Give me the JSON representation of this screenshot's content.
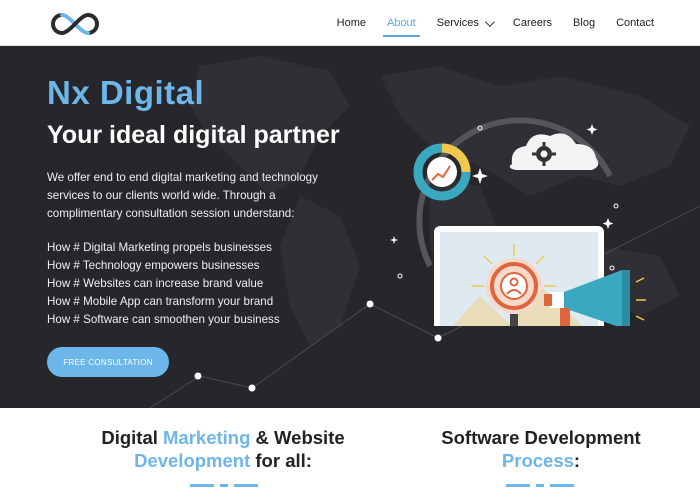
{
  "nav": {
    "items": [
      "Home",
      "About",
      "Services",
      "Careers",
      "Blog",
      "Contact"
    ],
    "active": "About"
  },
  "hero": {
    "title": "Nx Digital",
    "subtitle": "Your ideal digital partner",
    "description": "We offer end to end digital marketing and technology services to our clients world wide. Through a complimentary consultation session understand:",
    "points": [
      "How # Digital Marketing propels businesses",
      "How # Technology empowers businesses",
      "How # Websites can increase brand value",
      "How # Mobile App can transform your brand",
      "How # Software can smoothen your business"
    ],
    "cta_label": "FREE CONSULTATION"
  },
  "sections": {
    "left": {
      "p1": "Digital ",
      "h1": "Marketing",
      "p2": " & Website ",
      "h2": "Development",
      "p3": " for all:"
    },
    "right": {
      "p1": "Software Development ",
      "h1": "Process",
      "p2": ":"
    }
  },
  "colors": {
    "accent": "#6db6ea",
    "hero_bg": "#26262b"
  }
}
